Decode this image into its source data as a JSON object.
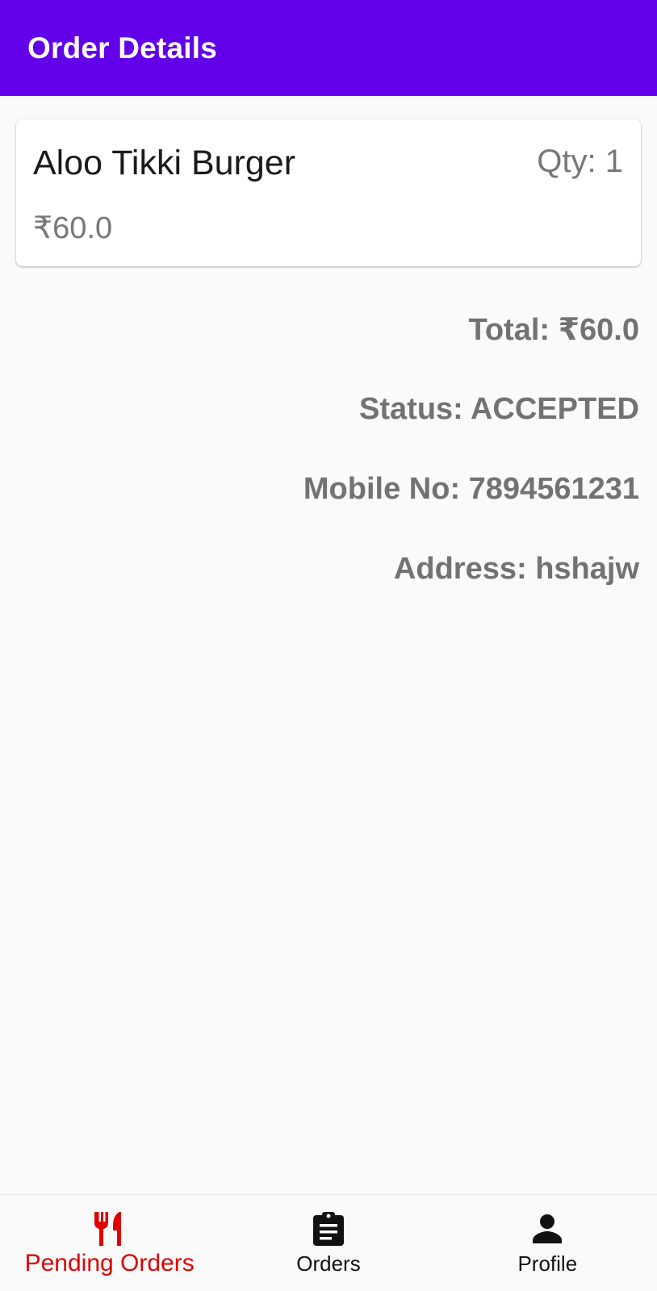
{
  "app_bar": {
    "title": "Order Details",
    "color": "#6200ea"
  },
  "order_item": {
    "name": "Aloo Tikki Burger",
    "qty": "Qty: 1",
    "price": "₹60.0"
  },
  "summary": {
    "total": "Total: ₹60.0",
    "status": "Status: ACCEPTED",
    "mobile": "Mobile No: 7894561231",
    "address": "Address: hshajw"
  },
  "bottom_nav": {
    "active_color": "#e00000",
    "items": [
      {
        "label": "Pending Orders",
        "icon": "restaurant-icon",
        "active": true
      },
      {
        "label": "Orders",
        "icon": "clipboard-icon",
        "active": false
      },
      {
        "label": "Profile",
        "icon": "person-icon",
        "active": false
      }
    ]
  }
}
